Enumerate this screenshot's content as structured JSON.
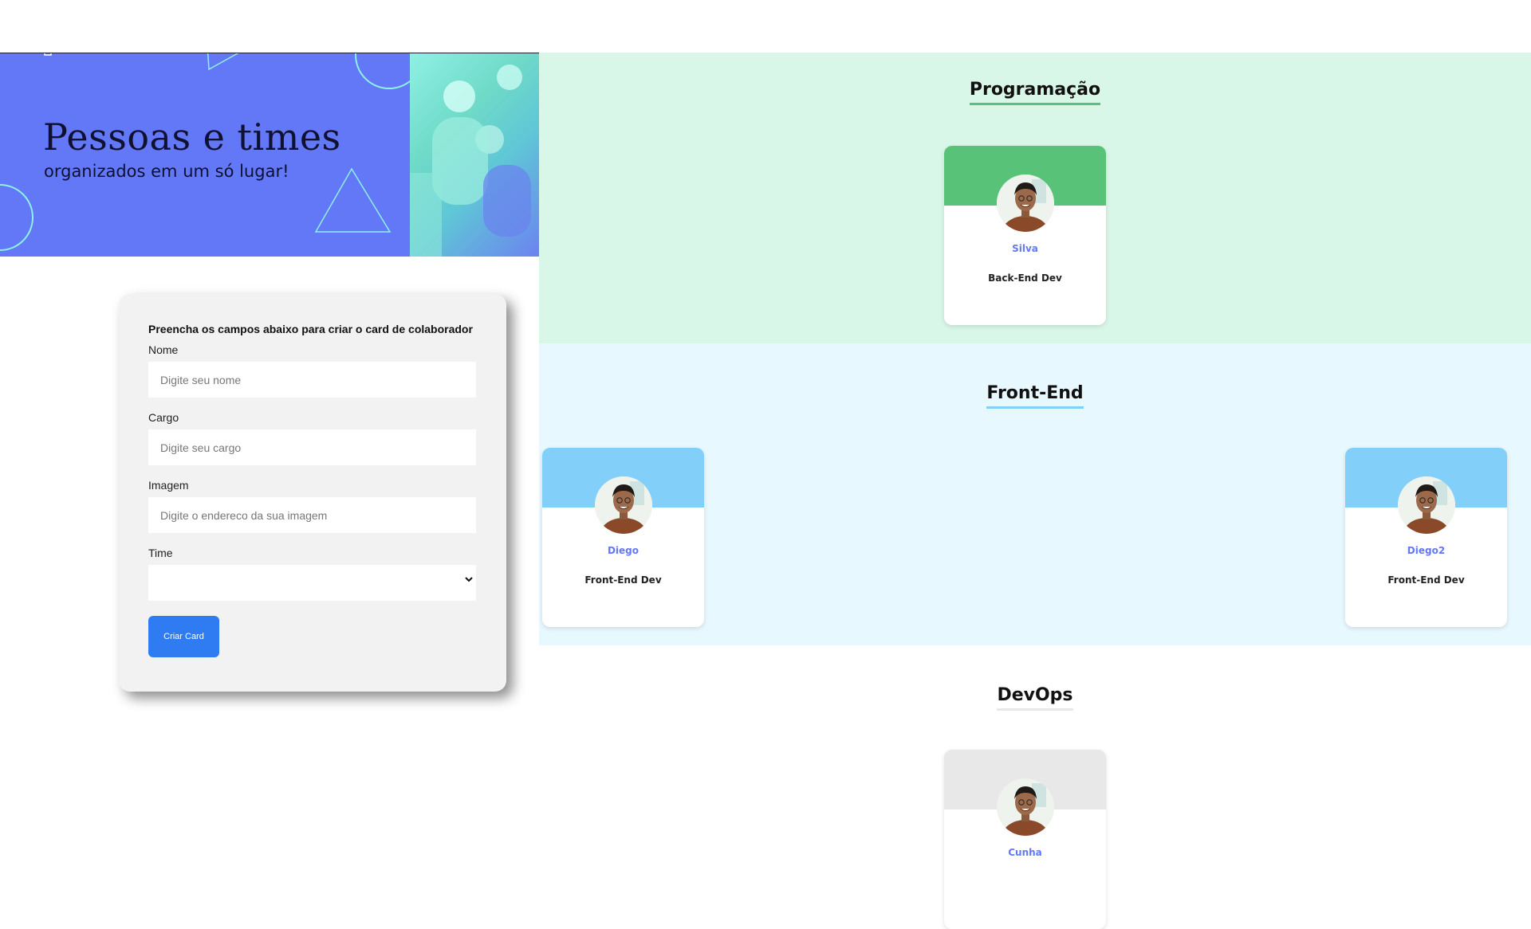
{
  "banner": {
    "title": "Pessoas e times",
    "subtitle": "organizados em um só lugar!"
  },
  "form": {
    "heading": "Preencha os campos abaixo para criar o card de colaborador",
    "fields": [
      {
        "label": "Nome",
        "placeholder": "Digite seu nome"
      },
      {
        "label": "Cargo",
        "placeholder": "Digite seu cargo"
      },
      {
        "label": "Imagem",
        "placeholder": "Digite o endereco da sua imagem"
      }
    ],
    "select": {
      "label": "Time",
      "value": ""
    },
    "submit_label": "Criar Card"
  },
  "teams": [
    {
      "name": "Programação",
      "primary_color": "#57c278",
      "secondary_color": "#d9f7e9",
      "members": [
        {
          "name": "Silva",
          "role": "Back-End Dev"
        }
      ]
    },
    {
      "name": "Front-End",
      "primary_color": "#82cffa",
      "secondary_color": "#e8f8ff",
      "members": [
        {
          "name": "Diego",
          "role": "Front-End Dev"
        },
        {
          "name": "Diego2",
          "role": "Front-End Dev"
        }
      ]
    },
    {
      "name": "DevOps",
      "primary_color": "#e8e8e8",
      "secondary_color": "#ffffff",
      "members": [
        {
          "name": "Cunha",
          "role": ""
        }
      ]
    }
  ],
  "icons": {
    "chevron": "chevron-down-icon",
    "avatar": "avatar"
  }
}
